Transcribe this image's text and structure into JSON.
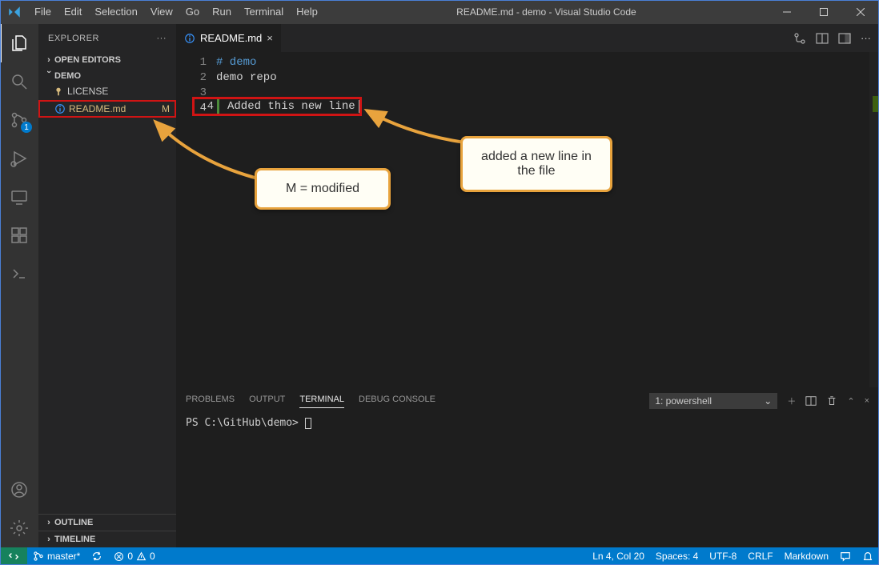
{
  "title": "README.md - demo - Visual Studio Code",
  "menu": [
    "File",
    "Edit",
    "Selection",
    "View",
    "Go",
    "Run",
    "Terminal",
    "Help"
  ],
  "explorer": {
    "title": "EXPLORER",
    "open_editors": "OPEN EDITORS",
    "folder": "DEMO",
    "files": [
      {
        "name": "LICENSE",
        "status": "",
        "modified": false
      },
      {
        "name": "README.md",
        "status": "M",
        "modified": true
      }
    ],
    "outline": "OUTLINE",
    "timeline": "TIMELINE"
  },
  "activity_badge": "1",
  "tab": {
    "name": "README.md"
  },
  "editor": {
    "line_numbers": [
      "1",
      "2",
      "3",
      "4"
    ],
    "line1": "# demo",
    "line2": "demo repo",
    "line4": "Added this new line"
  },
  "panel": {
    "tabs": [
      "PROBLEMS",
      "OUTPUT",
      "TERMINAL",
      "DEBUG CONSOLE"
    ],
    "select": "1: powershell",
    "prompt": "PS C:\\GitHub\\demo> "
  },
  "status": {
    "branch": "master*",
    "sync": "",
    "errors": "0",
    "warnings": "0",
    "ln_col": "Ln 4, Col 20",
    "spaces": "Spaces: 4",
    "encoding": "UTF-8",
    "eol": "CRLF",
    "lang": "Markdown"
  },
  "callouts": {
    "modified": "M = modified",
    "newline": "added a new line in the file"
  }
}
